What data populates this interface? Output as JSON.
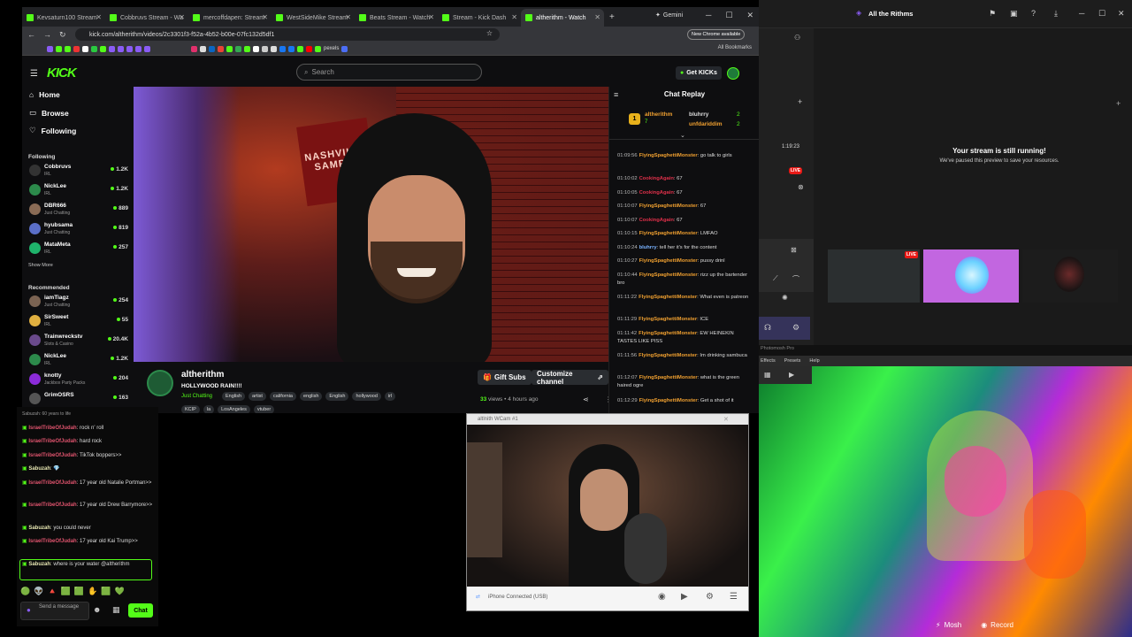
{
  "browser": {
    "tabs": [
      {
        "title": "Kevsaturn100 Stream"
      },
      {
        "title": "Cobbruvs Stream - Wa"
      },
      {
        "title": "mercoffdapen: Stream"
      },
      {
        "title": "WestSideMike Stream"
      },
      {
        "title": "Beats Stream - Watch"
      },
      {
        "title": "Stream - Kick Dash"
      },
      {
        "title": "altherithm - Watch"
      }
    ],
    "gemini_label": "Gemini",
    "url": "kick.com/altherithm/videos/2c3301f3-f52a-4b52-b00e-07fc132d5df1",
    "new_chrome": "New Chrome available",
    "bookmark_pexels": "pexels",
    "all_bookmarks": "All Bookmarks"
  },
  "kick": {
    "logo": "KICK",
    "search_placeholder": "Search",
    "get_kicks": "Get KICKs",
    "nav": {
      "home": "Home",
      "browse": "Browse",
      "following": "Following"
    },
    "following_title": "Following",
    "following": [
      {
        "name": "Cobbruvs",
        "category": "IRL",
        "viewers": "1.2K"
      },
      {
        "name": "NickLee",
        "category": "IRL",
        "viewers": "1.2K"
      },
      {
        "name": "DBR666",
        "category": "Just Chatting",
        "viewers": "889"
      },
      {
        "name": "hyubsama",
        "category": "Just Chatting",
        "viewers": "819"
      },
      {
        "name": "MataMeta",
        "category": "IRL",
        "viewers": "257"
      }
    ],
    "show_more": "Show More",
    "recommended_title": "Recommended",
    "recommended": [
      {
        "name": "iamTiagz",
        "category": "Just Chatting",
        "viewers": "254"
      },
      {
        "name": "SirSweet",
        "category": "IRL",
        "viewers": "55"
      },
      {
        "name": "Trainwreckstv",
        "category": "Slots & Casino",
        "viewers": "20.4K"
      },
      {
        "name": "NickLee",
        "category": "IRL",
        "viewers": "1.2K"
      },
      {
        "name": "knotty",
        "category": "Jackbox Party Packs",
        "viewers": "204"
      },
      {
        "name": "GrimOSRS",
        "category": "",
        "viewers": "163"
      }
    ],
    "video_sign": "NASHVILLE SAMPLE",
    "stream": {
      "username": "altherithm",
      "title": "HOLLYWOOD RAIN!!!!",
      "category": "Just Chatting",
      "tags": [
        "English",
        "artist",
        "california",
        "english",
        "English",
        "hollywood",
        "irl"
      ],
      "tags2": [
        "KCIP",
        "la",
        "LosAngeles",
        "vtuber"
      ],
      "gift_subs": "Gift Subs",
      "customize": "Customize channel",
      "views_count": "33",
      "views_label": "views",
      "ago": "4 hours ago"
    },
    "replay": {
      "title": "Chat Replay",
      "top_gifter": {
        "name": "altherithm",
        "count": "7"
      },
      "gifters": [
        {
          "name": "bluhrry",
          "count": "2"
        },
        {
          "name": "unfdariddim",
          "count": "2"
        }
      ],
      "messages": [
        {
          "time": "01:09:56",
          "user": "FlyingSpaghettiMonster",
          "color": "#f0a030",
          "text": "go talk to girls"
        },
        {
          "time": "01:10:02",
          "user": "CookingAgain",
          "color": "#e0304a",
          "text": "67"
        },
        {
          "time": "01:10:05",
          "user": "CookingAgain",
          "color": "#e0304a",
          "text": "67"
        },
        {
          "time": "01:10:07",
          "user": "FlyingSpaghettiMonster",
          "color": "#f0a030",
          "text": "67"
        },
        {
          "time": "01:10:07",
          "user": "CookingAgain",
          "color": "#e0304a",
          "text": "67"
        },
        {
          "time": "01:10:15",
          "user": "FlyingSpaghettiMonster",
          "color": "#f0a030",
          "text": "LMFAO"
        },
        {
          "time": "01:10:24",
          "user": "bluhrry",
          "color": "#7ab3ff",
          "text": "tell her it's for the content"
        },
        {
          "time": "01:10:27",
          "user": "FlyingSpaghettiMonster",
          "color": "#f0a030",
          "text": "pussy drinl"
        },
        {
          "time": "01:10:44",
          "user": "FlyingSpaghettiMonster",
          "color": "#f0a030",
          "text": "rizz up the bartender bro"
        },
        {
          "time": "01:11:22",
          "user": "FlyingSpaghettiMonster",
          "color": "#f0a030",
          "text": "What even is patreon"
        },
        {
          "time": "01:11:29",
          "user": "FlyingSpaghettiMonster",
          "color": "#f0a030",
          "text": "ICE"
        },
        {
          "time": "01:11:42",
          "user": "FlyingSpaghettiMonster",
          "color": "#f0a030",
          "text": "EW HEINEKIN TASTES LIKE PISS"
        },
        {
          "time": "01:11:56",
          "user": "FlyingSpaghettiMonster",
          "color": "#f0a030",
          "text": "Im drinking sambuca"
        },
        {
          "time": "01:12:07",
          "user": "FlyingSpaghettiMonster",
          "color": "#f0a030",
          "text": "what is the green haired ogre"
        },
        {
          "time": "01:12:29",
          "user": "FlyingSpaghettiMonster",
          "color": "#f0a030",
          "text": "Get a shot of it"
        }
      ]
    }
  },
  "right_app": {
    "title": "All the Rithms",
    "timer": "1:19:23",
    "live": "LIVE",
    "live2": "LIVE",
    "running_title": "Your stream is still running!",
    "running_sub": "We've paused this preview to save your resources."
  },
  "chat_overlay": {
    "top_partial": "Sabuzah: 60 years to life",
    "messages": [
      {
        "user": "IsraelTribeOfJudah",
        "text": "rock n' roll"
      },
      {
        "user": "IsraelTribeOfJudah",
        "text": "hard rock"
      },
      {
        "user": "IsraelTribeOfJudah",
        "text": "TikTok boppers>>"
      },
      {
        "user": "Sabuzah",
        "text": ""
      },
      {
        "user": "IsraelTribeOfJudah",
        "text": "17 year old Natalie Portman>>"
      },
      {
        "user": "IsraelTribeOfJudah",
        "text": "17 year old Drew Barrymore>>"
      },
      {
        "user": "Sabuzah",
        "text": "you could never"
      },
      {
        "user": "IsraelTribeOfJudah",
        "text": "17 year old Kai Trump>>"
      }
    ],
    "highlight": {
      "user": "Sabuzah",
      "text": "where is your water",
      "mention": "@altherithm"
    },
    "send_placeholder": "Send a message",
    "chat_button": "Chat"
  },
  "webcam": {
    "title": "altlnith WCam #1",
    "status": "iPhone Connected (USB)"
  },
  "mosh": {
    "app_name": "Photomosh Pro",
    "menu": [
      "Effects",
      "Presets",
      "Help"
    ],
    "mosh_btn": "Mosh",
    "record_btn": "Record"
  }
}
